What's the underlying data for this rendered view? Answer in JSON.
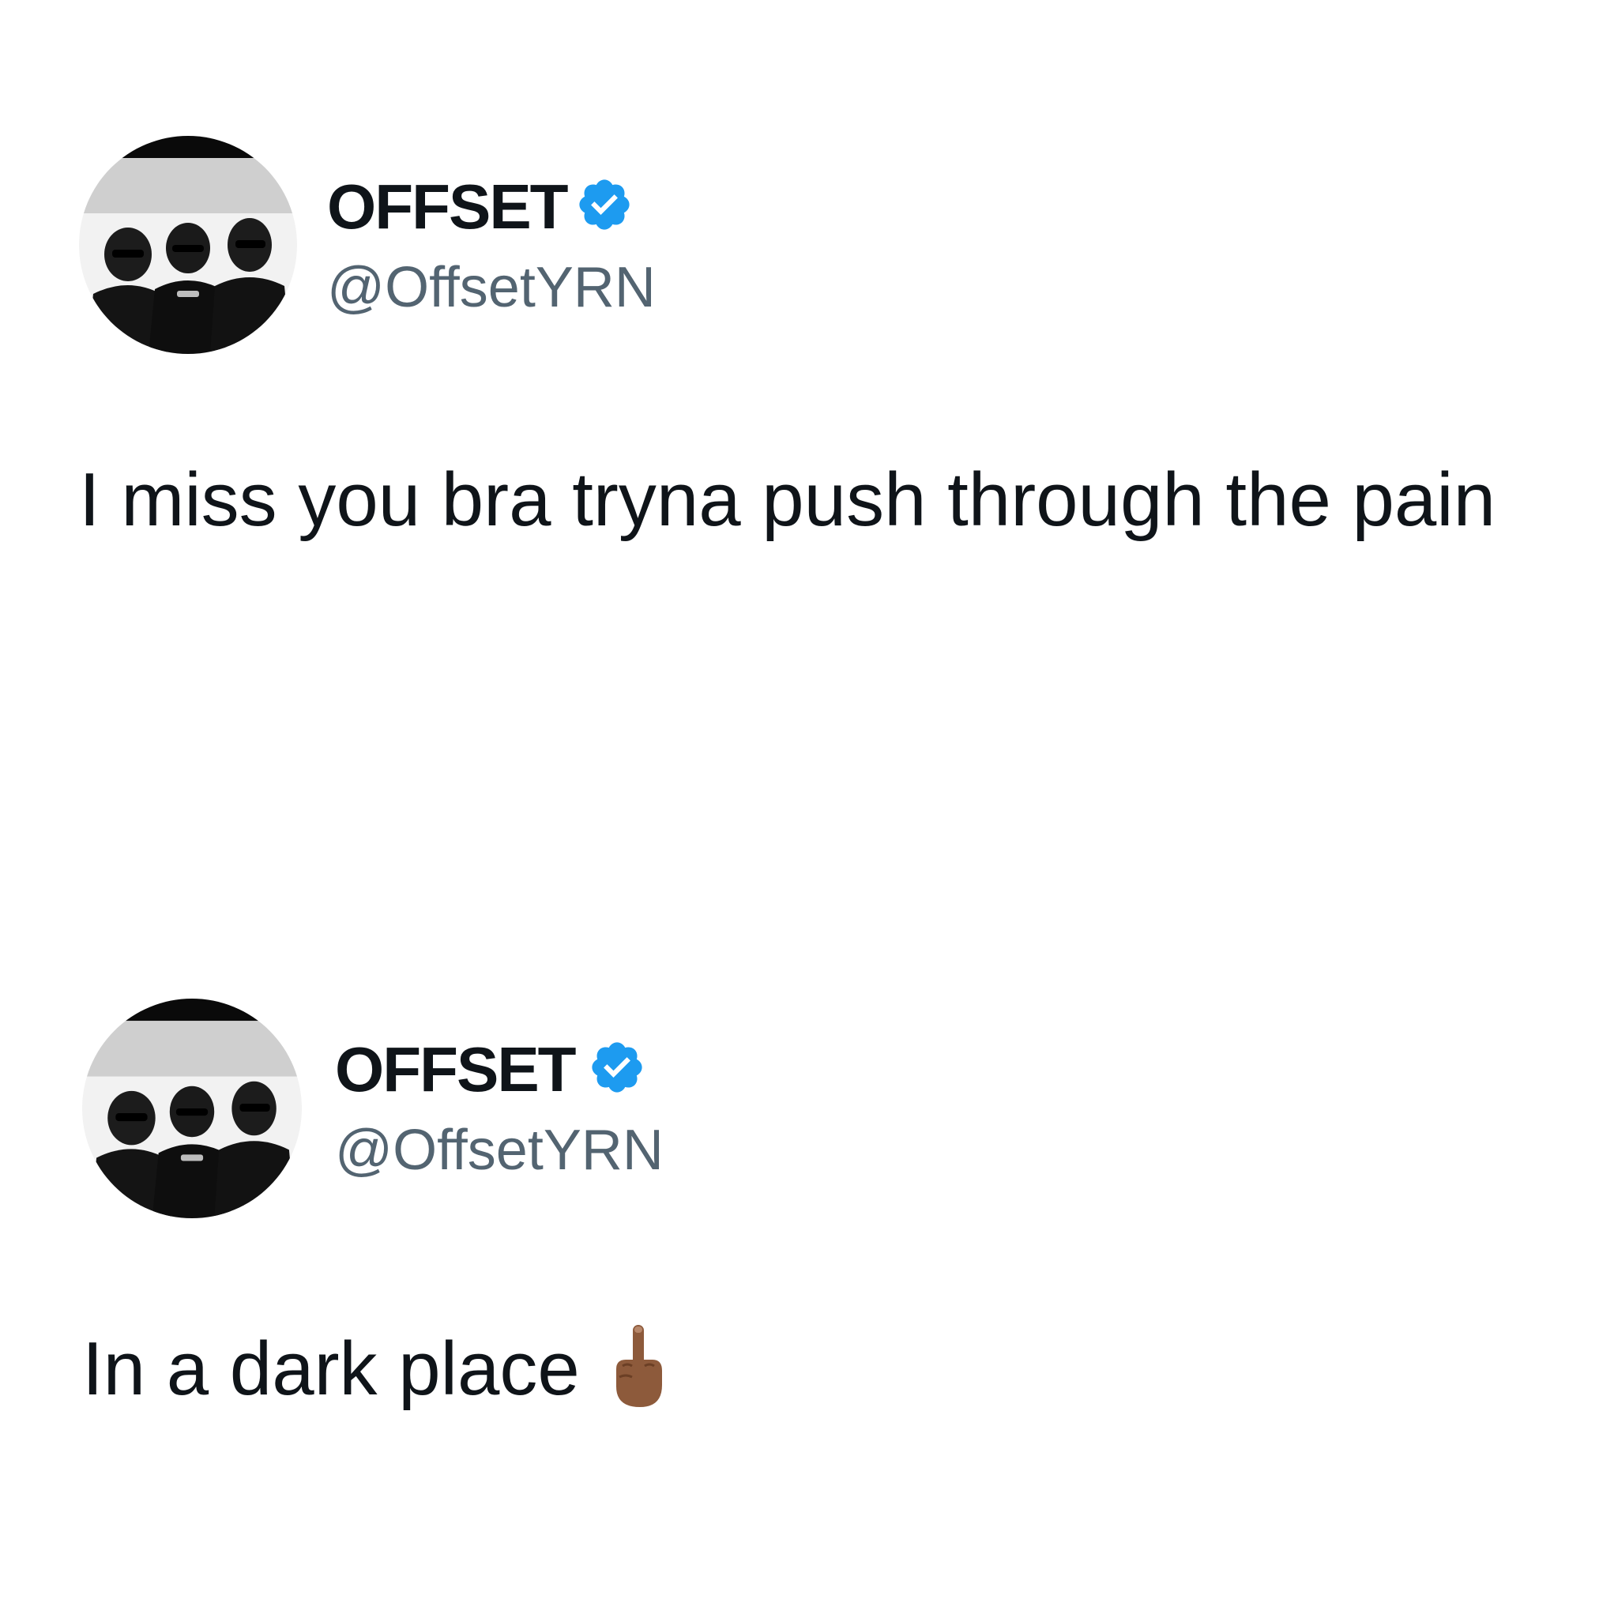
{
  "tweets": [
    {
      "display_name": "OFFSET",
      "handle": "@OffsetYRN",
      "text": "I miss you bra tryna push through the pain",
      "avatar_icon": "group-photo-avatar",
      "verified_icon": "verified-badge-icon",
      "verified_color": "#1d9bf0"
    },
    {
      "display_name": "OFFSET",
      "handle": "@OffsetYRN",
      "text": "In a dark place",
      "avatar_icon": "group-photo-avatar",
      "verified_icon": "verified-badge-icon",
      "verified_color": "#1d9bf0",
      "emoji_icon": "middle-finger-emoji-icon",
      "emoji_skin_color": "#8d5a3b"
    }
  ],
  "colors": {
    "text_primary": "#0f1419",
    "text_secondary": "#536471",
    "background": "#ffffff"
  }
}
